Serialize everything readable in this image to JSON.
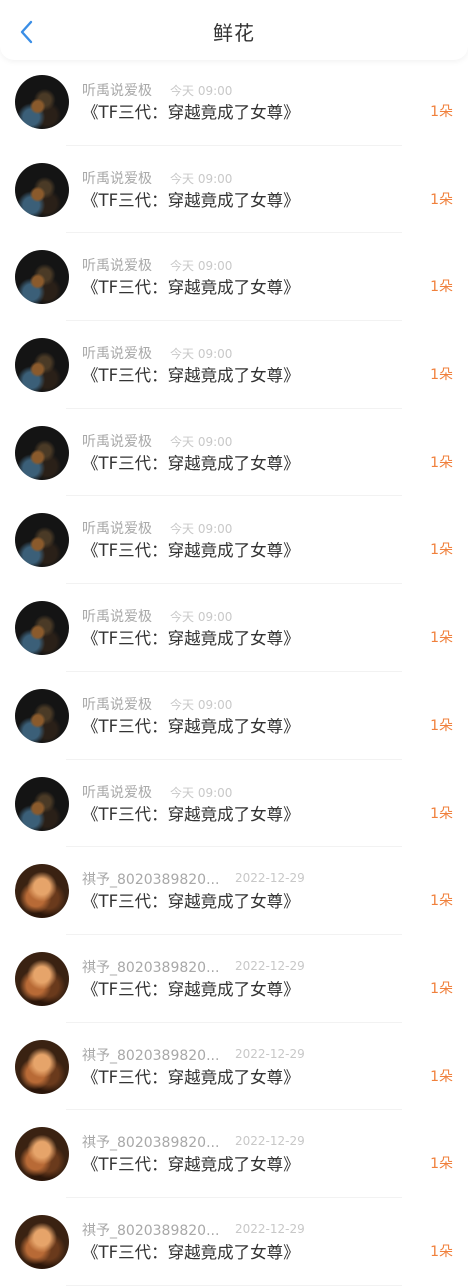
{
  "header": {
    "title": "鲜花",
    "back_icon": "chevron-left-icon",
    "back_color": "#3a8ee6"
  },
  "list": [
    {
      "user": "听禹说爱极",
      "time": "今天 09:00",
      "book": "《TF三代：穿越竟成了女尊》",
      "count": "1朵",
      "avatar": "dark"
    },
    {
      "user": "听禹说爱极",
      "time": "今天 09:00",
      "book": "《TF三代：穿越竟成了女尊》",
      "count": "1朵",
      "avatar": "dark"
    },
    {
      "user": "听禹说爱极",
      "time": "今天 09:00",
      "book": "《TF三代：穿越竟成了女尊》",
      "count": "1朵",
      "avatar": "dark"
    },
    {
      "user": "听禹说爱极",
      "time": "今天 09:00",
      "book": "《TF三代：穿越竟成了女尊》",
      "count": "1朵",
      "avatar": "dark"
    },
    {
      "user": "听禹说爱极",
      "time": "今天 09:00",
      "book": "《TF三代：穿越竟成了女尊》",
      "count": "1朵",
      "avatar": "dark"
    },
    {
      "user": "听禹说爱极",
      "time": "今天 09:00",
      "book": "《TF三代：穿越竟成了女尊》",
      "count": "1朵",
      "avatar": "dark"
    },
    {
      "user": "听禹说爱极",
      "time": "今天 09:00",
      "book": "《TF三代：穿越竟成了女尊》",
      "count": "1朵",
      "avatar": "dark"
    },
    {
      "user": "听禹说爱极",
      "time": "今天 09:00",
      "book": "《TF三代：穿越竟成了女尊》",
      "count": "1朵",
      "avatar": "dark"
    },
    {
      "user": "听禹说爱极",
      "time": "今天 09:00",
      "book": "《TF三代：穿越竟成了女尊》",
      "count": "1朵",
      "avatar": "dark"
    },
    {
      "user": "祺予_8020389820...",
      "time": "2022-12-29",
      "book": "《TF三代：穿越竟成了女尊》",
      "count": "1朵",
      "avatar": "warm"
    },
    {
      "user": "祺予_8020389820...",
      "time": "2022-12-29",
      "book": "《TF三代：穿越竟成了女尊》",
      "count": "1朵",
      "avatar": "warm"
    },
    {
      "user": "祺予_8020389820...",
      "time": "2022-12-29",
      "book": "《TF三代：穿越竟成了女尊》",
      "count": "1朵",
      "avatar": "warm"
    },
    {
      "user": "祺予_8020389820...",
      "time": "2022-12-29",
      "book": "《TF三代：穿越竟成了女尊》",
      "count": "1朵",
      "avatar": "warm"
    },
    {
      "user": "祺予_8020389820...",
      "time": "2022-12-29",
      "book": "《TF三代：穿越竟成了女尊》",
      "count": "1朵",
      "avatar": "warm"
    }
  ],
  "colors": {
    "accent": "#f0803c",
    "title": "#333333",
    "meta": "#a8a8a8"
  }
}
